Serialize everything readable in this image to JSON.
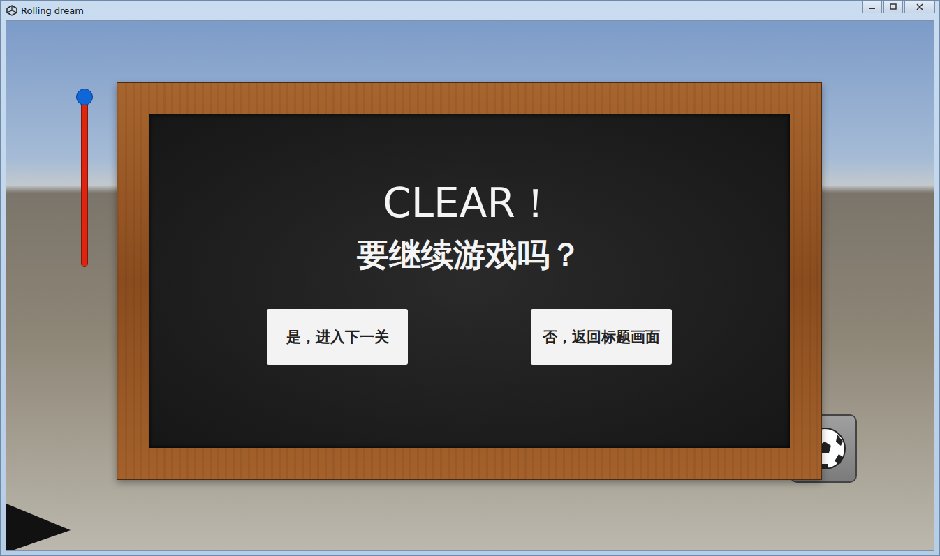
{
  "window": {
    "title": "Rolling dream"
  },
  "hud": {
    "power_gauge": {
      "level": 1
    }
  },
  "dialog": {
    "title": "CLEAR！",
    "question": "要继续游戏吗？",
    "buttons": [
      {
        "label": "是，进入下一关"
      },
      {
        "label": "否，返回标题画面"
      }
    ]
  }
}
